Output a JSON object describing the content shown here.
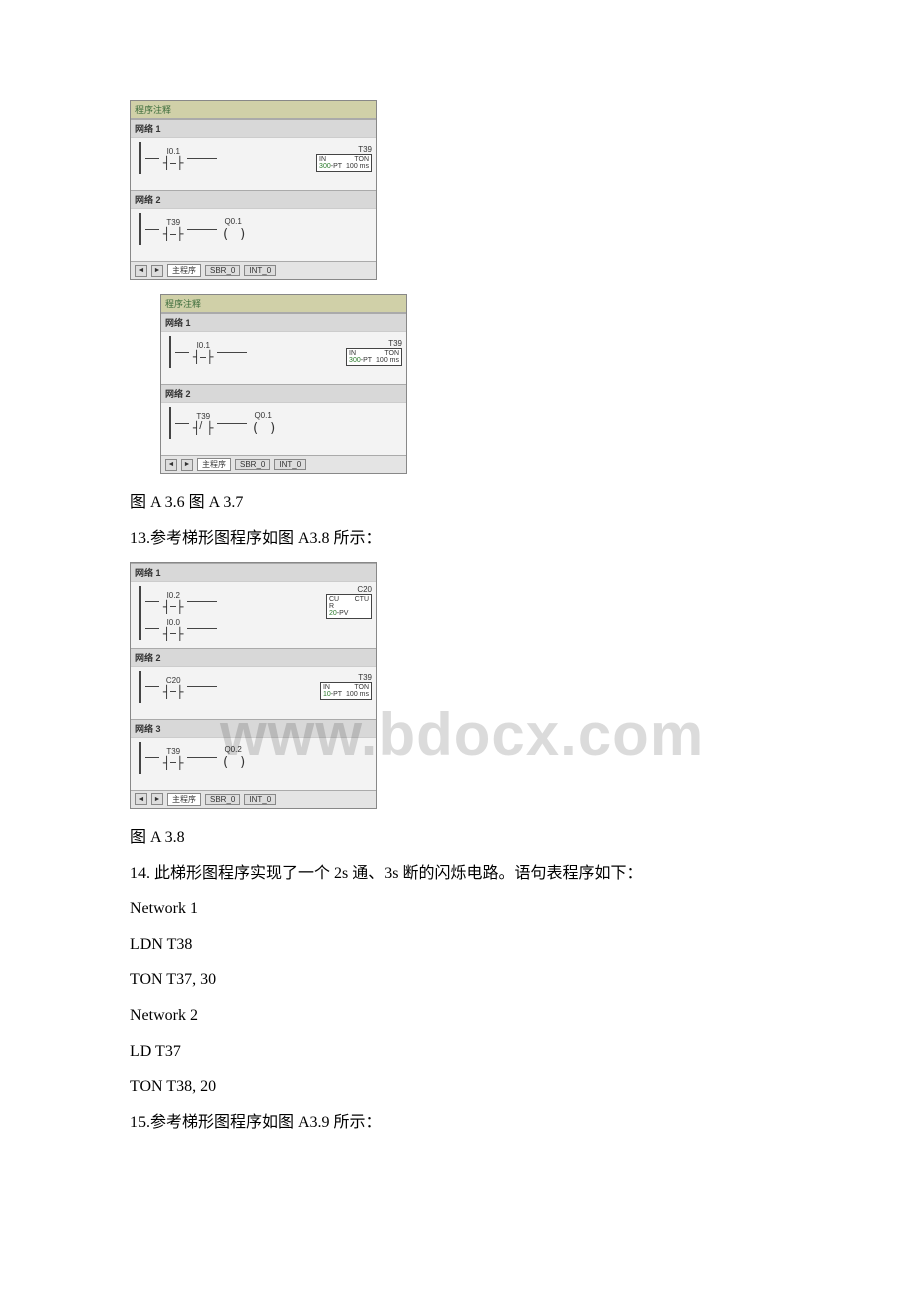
{
  "watermark": "www.bdocx.com",
  "fig_a36": {
    "head": "程序注释",
    "net1": "网络 1",
    "net2": "网络 2",
    "i01": "I0.1",
    "t39": "T39",
    "in": "IN",
    "ton": "TON",
    "pt": "PT",
    "ptval": "300",
    "tb": "100 ms",
    "q01": "Q0.1",
    "tabs": {
      "main": "主程序",
      "sbr": "SBR_0",
      "int": "INT_0"
    }
  },
  "fig_a37": {
    "head": "程序注释",
    "net1": "网络 1",
    "net2": "网络 2",
    "i01": "I0.1",
    "t39": "T39",
    "in": "IN",
    "ton": "TON",
    "pt": "PT",
    "ptval": "300",
    "tb": "100 ms",
    "q01": "Q0.1",
    "tabs": {
      "main": "主程序",
      "sbr": "SBR_0",
      "int": "INT_0"
    }
  },
  "caption_a36_a37": "图 A 3.6 图 A 3.7",
  "line13": "13.参考梯形图程序如图 A3.8 所示：",
  "fig_a38": {
    "net1": "网络 1",
    "net2": "网络 2",
    "net3": "网络 3",
    "i02": "I0.2",
    "i00": "I0.0",
    "c20": "C20",
    "cu": "CU",
    "ctu": "CTU",
    "r": "R",
    "pv": "PV",
    "pvval": "20",
    "t39": "T39",
    "in": "IN",
    "ton": "TON",
    "pt": "PT",
    "ptval": "10",
    "tb": "100 ms",
    "q02": "Q0.2",
    "tabs": {
      "main": "主程序",
      "sbr": "SBR_0",
      "int": "INT_0"
    }
  },
  "caption_a38": "图 A 3.8",
  "line14": "14. 此梯形图程序实现了一个 2s 通、3s 断的闪烁电路。语句表程序如下：",
  "stl": {
    "n1": "Network 1",
    "l1": "LDN T38",
    "l2": "TON T37, 30",
    "n2": "Network 2",
    "l3": "LD T37",
    "l4": "TON T38, 20"
  },
  "line15": "15.参考梯形图程序如图 A3.9 所示："
}
